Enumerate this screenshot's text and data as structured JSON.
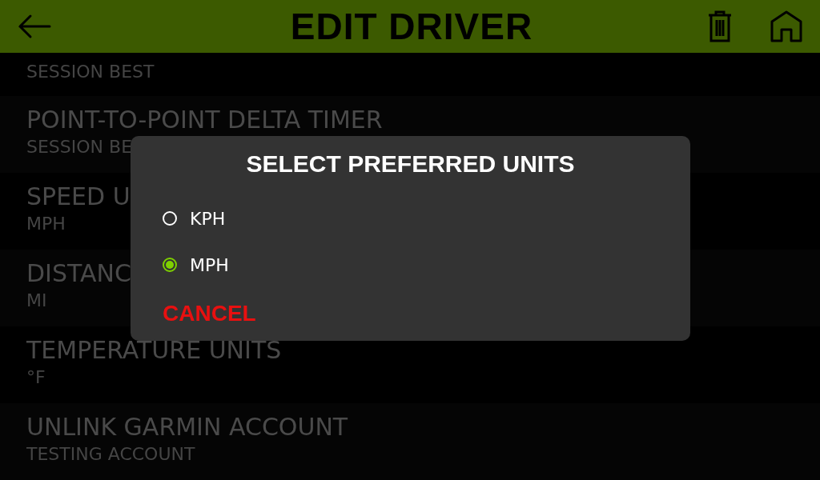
{
  "header": {
    "title": "EDIT DRIVER"
  },
  "settings": [
    {
      "value": "SESSION BEST"
    },
    {
      "title": "POINT-TO-POINT DELTA TIMER",
      "value": "SESSION BE"
    },
    {
      "title": "SPEED U",
      "value": "MPH"
    },
    {
      "title": "DISTANC",
      "value": "MI"
    },
    {
      "title": "TEMPERATURE UNITS",
      "value": "°F"
    },
    {
      "title": "UNLINK GARMIN ACCOUNT",
      "value": "TESTING ACCOUNT"
    }
  ],
  "dialog": {
    "title": "SELECT PREFERRED UNITS",
    "options": [
      {
        "label": "KPH",
        "selected": false
      },
      {
        "label": "MPH",
        "selected": true
      }
    ],
    "cancel": "CANCEL"
  }
}
